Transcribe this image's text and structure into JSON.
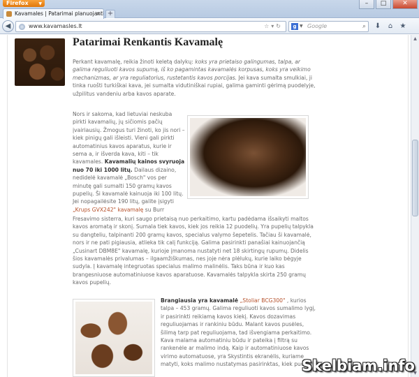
{
  "browser": {
    "app_button": "Firefox",
    "tab_title": "Kavamales | Patarimai planuojantiems isi...",
    "url": "www.kavamasles.lt",
    "search_placeholder": "Google",
    "search_engine_letter": "g"
  },
  "article": {
    "title": "Patarimai Renkantis Kavamalę",
    "p1_lead": "Perkant kavamalę, reikia žinoti keletą dalykų:",
    "p1_em": "koks yra prietaiso galingumas, talpa, ar galima reguliuoti kavos supumą, iš ko pagamintas kavamalės korpusas, koks yra veikimo mechanizmas, ar yra reguliatorius, rustetantis kavos porcijas.",
    "p1_tail": "Jei kava sumalta smulkiai, ji tinka ruošti turkiškai kava, jei sumalta vidutiniškai rupiai, galima gaminti gėrimą puodelyje, užpilitus vandeniu arba kavos aparate.",
    "p2_a": "Nors ir sakoma, kad lietuviai neskuba pirkti kavamalių, jų sičiomis pačių įvairiausių. Žmogus turi žinoti, ko jis nori – kiek pinigų gali išleisti. Vieni gali pirkti automatinius kavos aparatus, kurie ir sema a, ir išverda kava, kiti – tik kavamales.",
    "p2_bold": "Kavamalių kainos svyruoja nuo 70 iki 1000 litų.",
    "p2_b": "Dailaus dizaino, nedidelė kavamalė „Bosch\" vos per minutę gali sumalti 150 gramų kavos pupelių. Ši kavamalė kainuoja iki 100 litų. Jei nopagailėsite 190 litų, galite įsigyti",
    "p2_link": "„Krups GVX242\" kavamalę",
    "p2_c": "su Burr",
    "p3": "Fresavimo sisterra, kuri saugo prietaisą nuo perkaitimo, kartu padėdama išsaikyti maltos kavos aromatą ir skonį. Sumala tiek kavos, kiek jos reikia 12 puodelių. Yra pupelių talpykla su dangteliu, talpinanti 200 gramų kavos, specialus valymo šepetelis. Tačiau ši kavamalė, nors ir ne pati pigiausia, atlieka tik calį funkciją. Galima pasirinkti panašiai kainuojančią „Cusinart DBM8E\" kavamalę, kurioje įmanoma nustatyti net 18 skirtingų rupumų. Didelis šios kavamalės privalumas – ilgaamžiškumas, nes joje nėra plėlukų, kurie laiko bėgyje sudyla. Į kavamalę integruotas specialus malimo malinėlis. Taks būna ir kuo kas brangesniuose automatiniuose kavos aparatuose. Kavamalės talpykla skirta 250 gramų kavos pupelių.",
    "p4_bold": "Brangiausia yra kavamalė",
    "p4_link": "„Stoliar BCG300\"",
    "p4_a": ", kurios talpa – 453 gramų. Galima reguliuoti kavos sumalimo lygį, ir pasirinkti reikiamą kavos kiekį. Kavos dozavimas reguliuojamas ir rankiniu būdu. Malant kavos pusėles, šilimą tarp pat reguliuojama, tad išvengiama perkaitimo. Kava malama automatiniu būdu ir pateika į filtrą su rankenėle ar malimo indą. Kaip ir automatiniuose kavos virimo automatuose, yra Skystintis ekranėlis, kuriame matyti, koks malimo nustatymas pasirinktas, kiek puodelių"
  },
  "watermark": "Skelbiam.info"
}
